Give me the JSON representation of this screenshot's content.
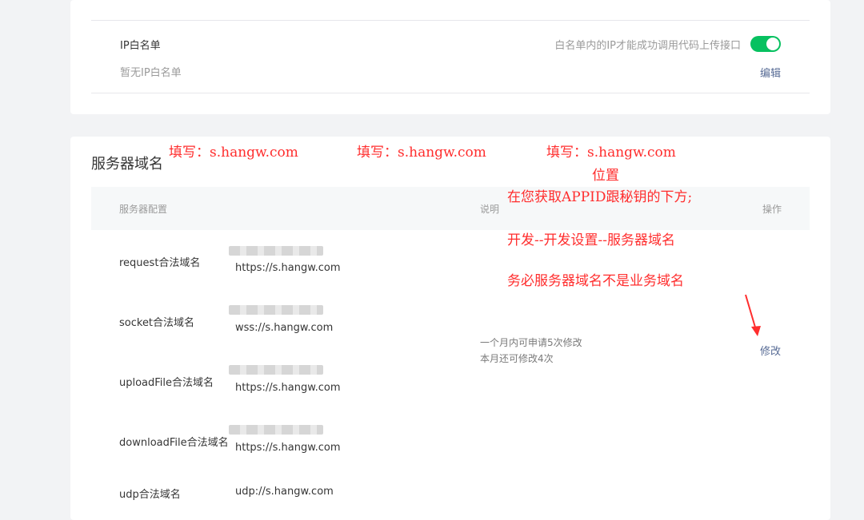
{
  "ip_whitelist": {
    "title": "IP白名单",
    "empty_text": "暂无IP白名单",
    "note": "白名单内的IP才能成功调用代码上传接口",
    "toggle_on": true,
    "edit_label": "编辑"
  },
  "server_domain": {
    "title": "服务器域名",
    "columns": {
      "config": "服务器配置",
      "desc": "说明",
      "action": "操作"
    },
    "rows": [
      {
        "label": "request合法域名",
        "url": "https://s.hangw.com"
      },
      {
        "label": "socket合法域名",
        "url": "wss://s.hangw.com"
      },
      {
        "label": "uploadFile合法域名",
        "url": "https://s.hangw.com"
      },
      {
        "label": "downloadFile合法域名",
        "url": "https://s.hangw.com"
      },
      {
        "label": "udp合法域名",
        "url": "udp://s.hangw.com"
      }
    ],
    "desc_line1": "一个月内可申请5次修改",
    "desc_line2": "本月还可修改4次",
    "modify_label": "修改"
  },
  "annotations": {
    "fill1": "填写：s.hangw.com",
    "fill2": "填写：s.hangw.com",
    "fill3": "填写：s.hangw.com",
    "position": "位置",
    "line1": "在您获取APPID跟秘钥的下方;",
    "line2": "开发--开发设置--服务器域名",
    "line3": "务必服务器域名不是业务域名",
    "color": "#ff2d2d"
  },
  "colors": {
    "accent": "#07c160",
    "link": "#576b95"
  }
}
